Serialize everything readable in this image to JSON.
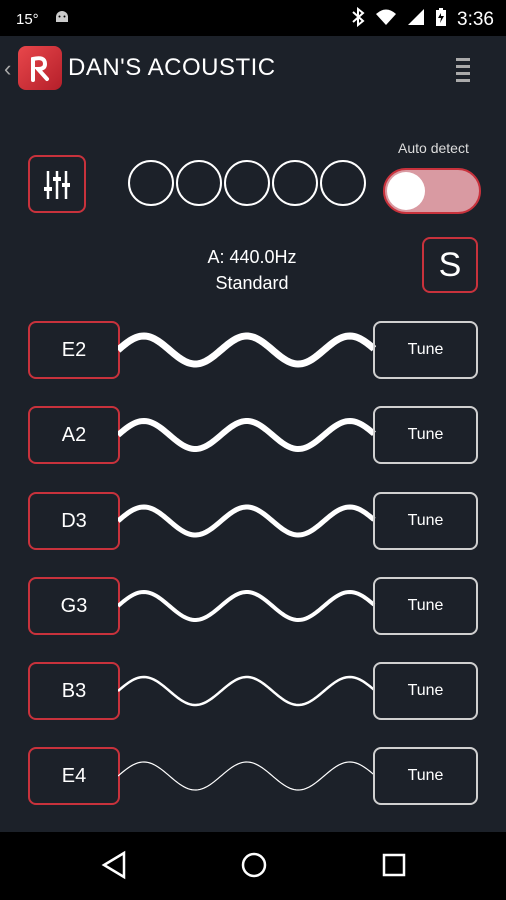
{
  "status": {
    "temperature": "15°",
    "time": "3:36"
  },
  "appbar": {
    "title": "DAN'S ACOUSTIC"
  },
  "controls": {
    "auto_detect_label": "Auto detect",
    "auto_detect_on": true,
    "s_label": "S"
  },
  "tuning": {
    "reference": "A: 440.0Hz",
    "name": "Standard"
  },
  "strings": [
    {
      "note": "E2",
      "tune_label": "Tune"
    },
    {
      "note": "A2",
      "tune_label": "Tune"
    },
    {
      "note": "D3",
      "tune_label": "Tune"
    },
    {
      "note": "G3",
      "tune_label": "Tune"
    },
    {
      "note": "B3",
      "tune_label": "Tune"
    },
    {
      "note": "E4",
      "tune_label": "Tune"
    }
  ],
  "icons": [
    "back-icon",
    "app-logo-icon",
    "menu-icon",
    "equalizer-icon",
    "bluetooth-icon",
    "wifi-icon",
    "battery-icon",
    "nav-back-icon",
    "nav-home-icon",
    "nav-recents-icon"
  ]
}
